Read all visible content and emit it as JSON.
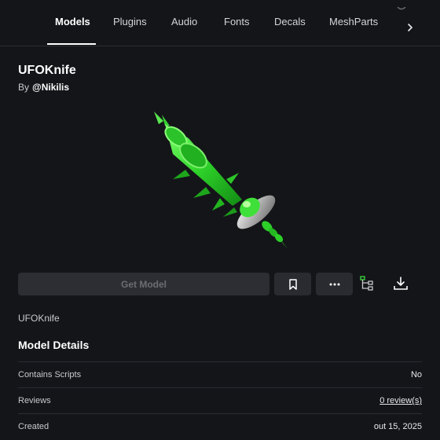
{
  "tabs": [
    {
      "label": "Models",
      "active": true
    },
    {
      "label": "Plugins"
    },
    {
      "label": "Audio"
    },
    {
      "label": "Fonts"
    },
    {
      "label": "Decals"
    },
    {
      "label": "MeshParts"
    }
  ],
  "tabs_more_icon": "chevron-right-icon",
  "asset": {
    "title": "UFOKnife",
    "by_label": "By",
    "creator": "@Nikilis",
    "name": "UFOKnife"
  },
  "actions": {
    "get_model_label": "Get Model",
    "save_icon": "bookmark-icon",
    "more_icon": "ellipsis-icon",
    "hierarchy_icon": "hierarchy-tree-icon",
    "download_icon": "download-icon"
  },
  "details": {
    "heading": "Model Details",
    "rows": [
      {
        "label": "Contains Scripts",
        "value": "No"
      },
      {
        "label": "Reviews",
        "value": "0 review(s)"
      },
      {
        "label": "Created",
        "value": "out 15, 2025"
      }
    ]
  },
  "colors": {
    "background": "#141519",
    "button": "#2a2b30",
    "accent_green": "#3ddc3d"
  }
}
